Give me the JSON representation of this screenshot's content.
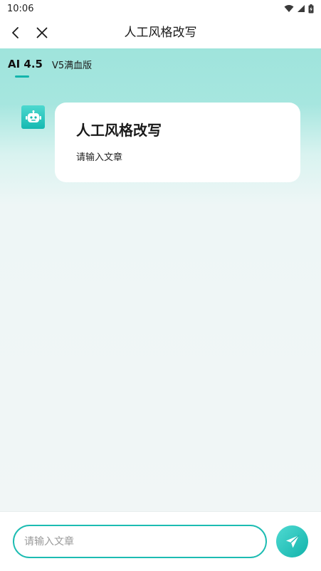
{
  "status_bar": {
    "time": "10:06"
  },
  "header": {
    "title": "人工风格改写",
    "back_icon": "chevron-left-icon",
    "close_icon": "close-icon"
  },
  "tabs": [
    {
      "label": "AI 4.5",
      "active": true
    },
    {
      "label": "V5满血版",
      "active": false
    }
  ],
  "message": {
    "avatar_icon": "robot-icon",
    "title": "人工风格改写",
    "text": "请输入文章"
  },
  "composer": {
    "placeholder": "请输入文章",
    "send_icon": "send-icon"
  },
  "colors": {
    "accent": "#13b5ac",
    "header_gradient_top": "#9fe4dc",
    "background": "#f1f6f6"
  }
}
